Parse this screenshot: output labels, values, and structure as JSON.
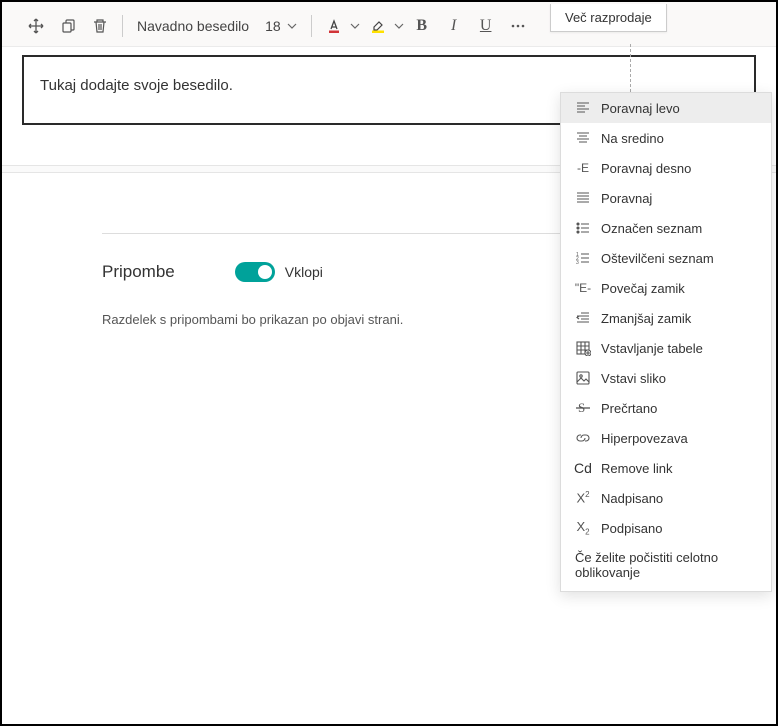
{
  "tooltip": "Več razprodaje",
  "toolbar": {
    "style": "Navadno besedilo",
    "size": "18"
  },
  "editor": {
    "placeholder": "Tukaj dodajte svoje besedilo."
  },
  "comments": {
    "title": "Pripombe",
    "toggle_label": "Vklopi",
    "description": "Razdelek s pripombami bo prikazan po objavi strani."
  },
  "menu": [
    {
      "icon": "align-left",
      "label": "Poravnaj levo",
      "highlighted": true
    },
    {
      "icon": "align-center",
      "label": "Na sredino"
    },
    {
      "icon": "align-right-e",
      "label": "Poravnaj desno"
    },
    {
      "icon": "align-justify",
      "label": "Poravnaj"
    },
    {
      "icon": "bullet",
      "label": "Označen seznam"
    },
    {
      "icon": "number",
      "label": "Oštevilčeni seznam"
    },
    {
      "icon": "indent-e",
      "label": "Povečaj zamik"
    },
    {
      "icon": "outdent",
      "label": "Zmanjšaj zamik"
    },
    {
      "icon": "table",
      "label": "Vstavljanje tabele"
    },
    {
      "icon": "image",
      "label": "Vstavi sliko"
    },
    {
      "icon": "strike",
      "label": "Prečrtano"
    },
    {
      "icon": "link",
      "label": "Hiperpovezava"
    },
    {
      "icon": "unlink",
      "label": "Remove link"
    },
    {
      "icon": "super",
      "label": "Nadpisano"
    },
    {
      "icon": "sub",
      "label": "Podpisano"
    },
    {
      "icon": "",
      "label": "Če želite počistiti celotno oblikovanje"
    }
  ]
}
